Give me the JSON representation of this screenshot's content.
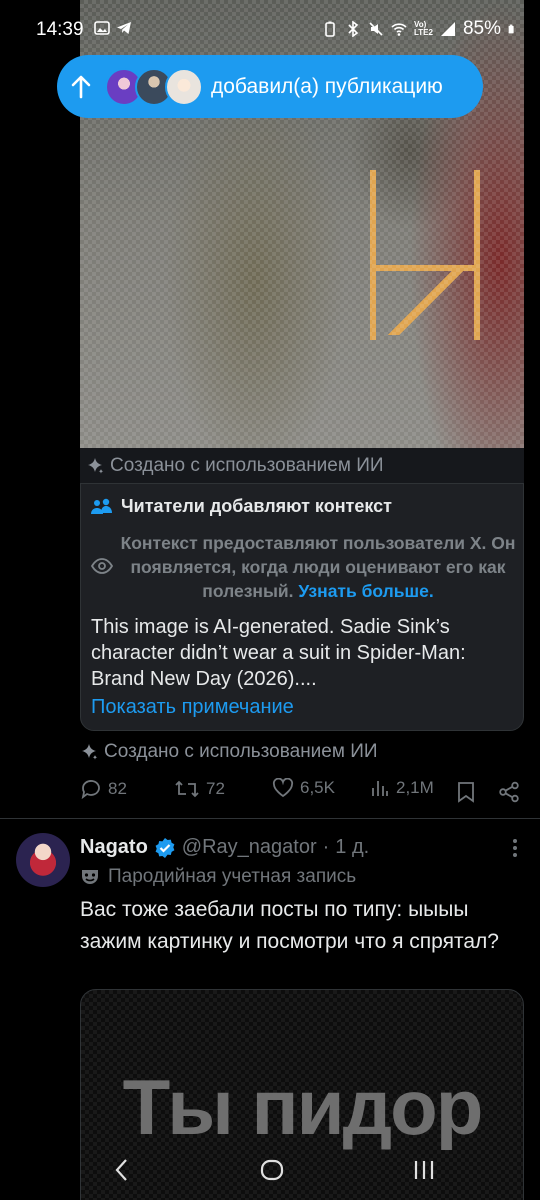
{
  "status_bar": {
    "time": "14:39",
    "battery": "85%",
    "net_label_top": "Vo)",
    "net_label_bottom": "LTE2"
  },
  "new_posts_pill": {
    "label": "добавил(а) публикацию",
    "avatar_colors": [
      "#6a3ec2",
      "#3b4a5c",
      "#e9e4de"
    ]
  },
  "post": {
    "ai_label": "Создано с использованием ИИ",
    "community_note": {
      "title": "Читатели добавляют контекст",
      "subtitle": "Контекст предоставляют пользователи X. Он появляется, когда люди оценивают его как полезный.",
      "learn_more": "Узнать больше.",
      "body": "This image is AI-generated. Sadie Sink’s character didn’t wear a suit in Spider-Man: Brand New Day (2026)....",
      "show_note": "Показать примечание"
    },
    "ai_label_bottom": "Создано с использованием ИИ",
    "actions": {
      "replies": "82",
      "reposts": "72",
      "likes": "6,5K",
      "views": "2,1M"
    }
  },
  "tweet2": {
    "name": "Nagato",
    "handle": "@Ray_nagator",
    "separator": "·",
    "time": "1 д.",
    "parody_label": "Пародийная учетная запись",
    "text": "Вас тоже заебали посты по типу: ыыыы зажим картинку и посмотри что я спрятал?",
    "media_text": "Ты пидор"
  },
  "colors": {
    "accent": "#1d9bf0",
    "muted": "#71767b",
    "background": "#000000"
  }
}
